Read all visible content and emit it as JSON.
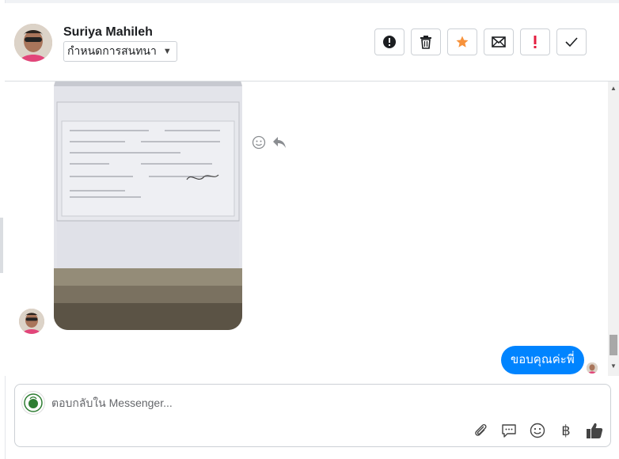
{
  "header": {
    "user_name": "Suriya Mahileh",
    "assign_label": "กำหนดการสนทนา",
    "actions": [
      {
        "name": "mark-spam-button",
        "icon": "alert-circle-icon"
      },
      {
        "name": "delete-button",
        "icon": "trash-icon"
      },
      {
        "name": "star-button",
        "icon": "star-icon"
      },
      {
        "name": "mark-unread-button",
        "icon": "envelope-icon"
      },
      {
        "name": "follow-up-button",
        "icon": "exclamation-icon"
      },
      {
        "name": "mark-done-button",
        "icon": "checkmark-icon"
      }
    ]
  },
  "conversation": {
    "outgoing_message": "ขอบคุณค่ะพี่"
  },
  "composer": {
    "placeholder": "ตอบกลับใน Messenger...",
    "currency_symbol": "฿"
  },
  "colors": {
    "accent": "#0084ff",
    "star": "#f7923b",
    "danger": "#e41e3f"
  }
}
